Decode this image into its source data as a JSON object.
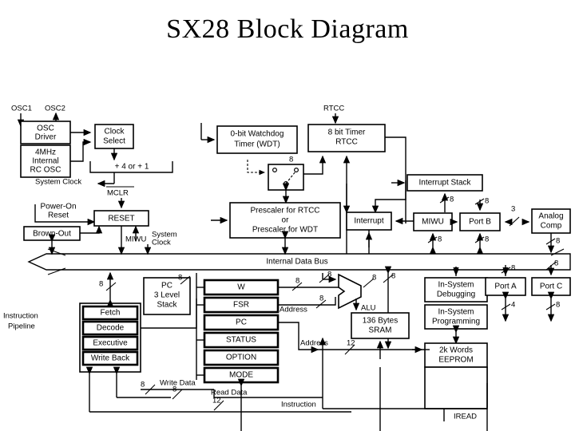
{
  "page": {
    "title": "SX28 Block Diagram"
  },
  "diagram": {
    "pins": {
      "osc1": "OSC1",
      "osc2": "OSC2",
      "rtcc": "RTCC",
      "mclr": "MCLR"
    },
    "blocks": {
      "osc_driver_l1": "OSC",
      "osc_driver_l2": "Driver",
      "internal_rc_l1": "4MHz",
      "internal_rc_l2": "Internal",
      "internal_rc_l3": "RC OSC",
      "clock_select_l1": "Clock",
      "clock_select_l2": "Select",
      "divider": "+ 4 or + 1",
      "system_clock": "System Clock",
      "power_on_reset_l1": "Power-On",
      "power_on_reset_l2": "Reset",
      "brown_out": "Brown-Out",
      "reset": "RESET",
      "miwu_left": "MIWU",
      "system_clock_2_l1": "System",
      "system_clock_2_l2": "Clock",
      "wdt_l1": "0-bit Watchdog",
      "wdt_l2": "Timer (WDT)",
      "timer_l1": "8 bit Timer",
      "timer_l2": "RTCC",
      "prescaler_l1": "Prescaler for RTCC",
      "prescaler_l2": "or",
      "prescaler_l3": "Prescaler for WDT",
      "interrupt": "Interrupt",
      "interrupt_stack": "Interrupt Stack",
      "miwu_right": "MIWU",
      "port_b": "Port B",
      "analog_comp_l1": "Analog",
      "analog_comp_l2": "Comp",
      "internal_data_bus": "Internal Data Bus",
      "instruction_pipeline_l1": "Instruction",
      "instruction_pipeline_l2": "Pipeline",
      "fetch": "Fetch",
      "decode": "Decode",
      "executive": "Executive",
      "write_back": "Write Back",
      "pc_stack_l1": "PC",
      "pc_stack_l2": "3 Level",
      "pc_stack_l3": "Stack",
      "reg_w": "W",
      "reg_fsr": "FSR",
      "reg_pc": "PC",
      "reg_status": "STATUS",
      "reg_option": "OPTION",
      "reg_mode": "MODE",
      "alu": "ALU",
      "sram_l1": "136 Bytes",
      "sram_l2": "SRAM",
      "isd_l1": "In-System",
      "isd_l2": "Debugging",
      "isp_l1": "In-System",
      "isp_l2": "Programming",
      "eeprom_l1": "2k Words",
      "eeprom_l2": "EEPROM",
      "port_a": "Port A",
      "port_c": "Port C",
      "iread": "IREAD"
    },
    "signal_labels": {
      "address_1": "Address",
      "address_2": "Address",
      "write_data": "Write Data",
      "read_data": "Read Data",
      "instruction": "Instruction"
    },
    "bus_widths": {
      "stack_8": "8",
      "portb_top_8": "8",
      "portb_3": "3",
      "miwu_8": "8",
      "portb_bot_8": "8",
      "analog_8": "8",
      "pipeline_8": "8",
      "pc_8": "8",
      "w_8": "8",
      "fsr_8": "8",
      "alu_in_8": "8",
      "alu_out_8": "8",
      "alu_bus_8": "8",
      "porta_in_8": "8",
      "porta_out_4": "4",
      "portc_in_8": "8",
      "portc_out_8": "8",
      "address_12": "12",
      "write_data_8": "8",
      "read_data_8": "8",
      "instruction_12": "12",
      "timer_8": "8",
      "isd_8": "8"
    },
    "colors": {
      "ink": "#000000",
      "paper": "#ffffff"
    }
  }
}
